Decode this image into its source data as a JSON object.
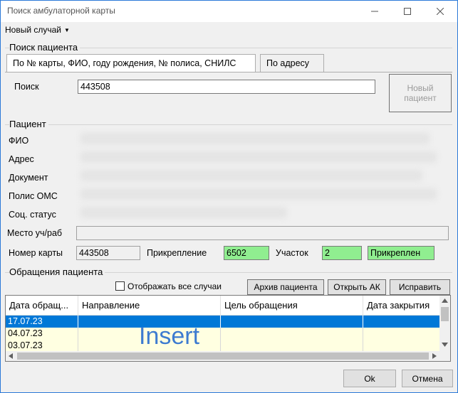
{
  "window": {
    "title": "Поиск амбулаторной карты",
    "icons": [
      "minimize-icon",
      "maximize-icon",
      "close-icon"
    ]
  },
  "menu": {
    "new_case": "Новый случай"
  },
  "search": {
    "group_label": "Поиск пациента",
    "tabs": [
      {
        "label": "По № карты, ФИО, году рождения, № полиса, СНИЛС",
        "active": true
      },
      {
        "label": "По адресу",
        "active": false
      }
    ],
    "search_label": "Поиск",
    "search_value": "443508",
    "new_patient_line1": "Новый",
    "new_patient_line2": "пациент"
  },
  "patient": {
    "group_label": "Пациент",
    "fio_label": "ФИО",
    "address_label": "Адрес",
    "document_label": "Документ",
    "policy_label": "Полис ОМС",
    "social_label": "Соц. статус",
    "place_label": "Место уч/раб",
    "place_value": "",
    "card_label": "Номер карты",
    "card_value": "443508",
    "attach_label": "Прикрепление",
    "attach_value": "6502",
    "district_label": "Участок",
    "district_value": "2",
    "status_value": "Прикреплен"
  },
  "visits": {
    "group_label": "Обращения пациента",
    "show_all_label": "Отображать все случаи",
    "show_all_checked": false,
    "archive_button": "Архив пациента",
    "open_button": "Открыть АК",
    "fix_button": "Исправить",
    "columns": [
      "Дата обращ...",
      "Направление",
      "Цель обращения",
      "Дата закрытия"
    ],
    "rows": [
      {
        "date": "17.07.23",
        "selected": true
      },
      {
        "date": "04.07.23",
        "selected": false
      },
      {
        "date": "03.07.23",
        "selected": false
      }
    ],
    "overlay_text": "Insert"
  },
  "footer": {
    "ok": "Ok",
    "cancel": "Отмена"
  },
  "colors": {
    "selection": "#0078d7",
    "row_bg": "#ffffe1",
    "green": "#90ee90",
    "overlay": "#3d7bd0",
    "window_border": "#2b79d8"
  }
}
